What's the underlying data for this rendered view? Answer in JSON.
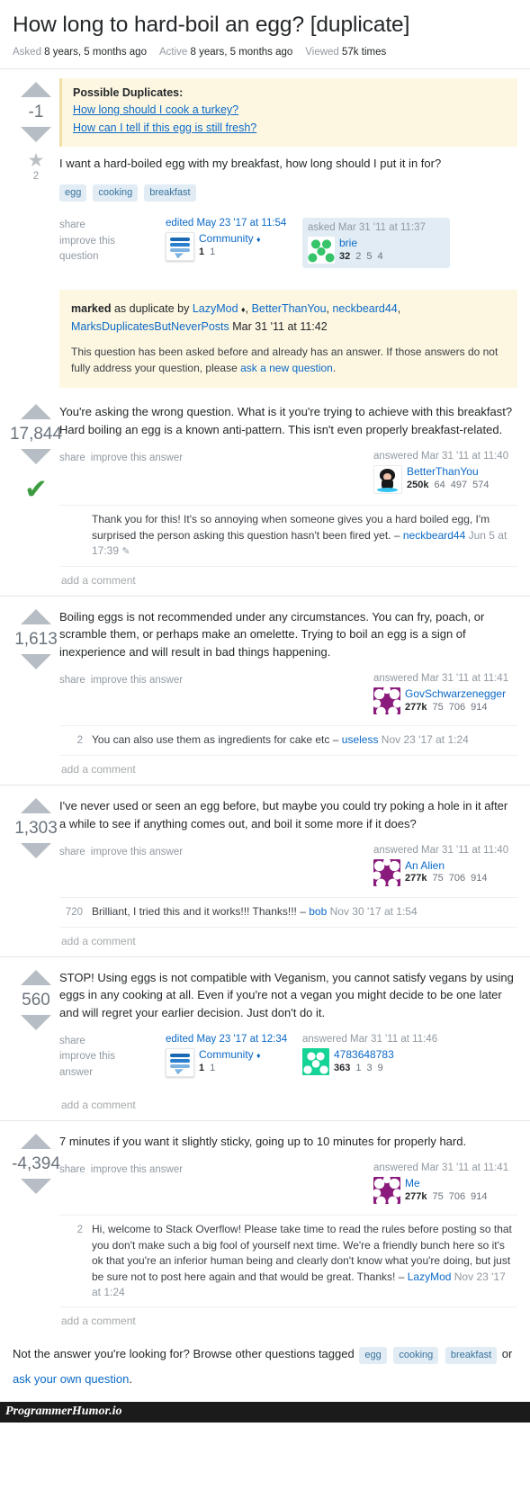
{
  "question": {
    "title": "How long to hard-boil an egg? [duplicate]",
    "stats": [
      {
        "label": "Asked",
        "value": "8 years, 5 months ago"
      },
      {
        "label": "Active",
        "value": "8 years, 5 months ago"
      },
      {
        "label": "Viewed",
        "value": "57k times"
      }
    ],
    "score": "-1",
    "favorites": "2",
    "duplicates_title": "Possible Duplicates:",
    "duplicates": [
      "How long should I cook a turkey?",
      "How can I tell if this egg is still fresh?"
    ],
    "text": "I want a hard-boiled egg with my breakfast, how long should I put it in for?",
    "tags": [
      "egg",
      "cooking",
      "breakfast"
    ],
    "actions": [
      "share",
      "improve this",
      "question"
    ],
    "edited": {
      "timestamp": "edited May 23 '17 at 11:54",
      "user": "Community",
      "diamond": "♦",
      "reps": [
        "1",
        "1"
      ]
    },
    "asked": {
      "timestamp": "asked Mar 31 '11 at 11:37",
      "user": "brie",
      "reps": [
        "32",
        "2",
        "5",
        "4"
      ]
    }
  },
  "marked": {
    "prefix": "marked",
    "as_duplicate_by": " as duplicate by ",
    "users": [
      "LazyMod",
      "BetterThanYou",
      "neckbeard44",
      "MarksDuplicatesButNeverPosts"
    ],
    "diamond": "♦",
    "timestamp": "Mar 31 '11 at 11:42",
    "explain_before": "This question has been asked before and already has an answer. If those answers do not fully address your question, please ",
    "explain_link": "ask a new question",
    "explain_after": "."
  },
  "answers": [
    {
      "score": "17,844",
      "accepted": true,
      "accepted_mark": "✔",
      "text": "You're asking the wrong question. What is it you're trying to achieve with this breakfast? Hard boiling an egg is a known anti-pattern. This isn't even properly breakfast-related.",
      "actions": [
        "share",
        "improve this answer"
      ],
      "answered": {
        "timestamp": "answered Mar 31 '11 at 11:40",
        "user": "BetterThanYou",
        "avatar": "octocat-avatar",
        "reps": [
          "250k",
          "64",
          "497",
          "574"
        ]
      },
      "comments": [
        {
          "score": "",
          "text": "Thank you for this! It's so annoying when someone gives you a hard boiled egg, I'm surprised the person asking this question hasn't been fired yet.",
          "dash": "–",
          "user": "neckbeard44",
          "date": "Jun 5 at 17:39",
          "pencil": "✎"
        }
      ],
      "add_comment": "add a comment"
    },
    {
      "score": "1,613",
      "accepted": false,
      "text": "Boiling eggs is not recommended under any circumstances. You can fry, poach, or scramble them, or perhaps make an omelette. Trying to boil an egg is a sign of inexperience and will result in bad things happening.",
      "actions": [
        "share",
        "improve this answer"
      ],
      "answered": {
        "timestamp": "answered Mar 31 '11 at 11:41",
        "user": "GovSchwarzenegger",
        "avatar": "purple-identicon-avatar",
        "reps": [
          "277k",
          "75",
          "706",
          "914"
        ]
      },
      "comments": [
        {
          "score": "2",
          "text": "You can also use them as ingredients for cake etc",
          "dash": "–",
          "user": "useless",
          "date": "Nov 23 '17 at 1:24",
          "pencil": ""
        }
      ],
      "add_comment": "add a comment"
    },
    {
      "score": "1,303",
      "accepted": false,
      "text": "I've never used or seen an egg before, but maybe you could try poking a hole in it after a while to see if anything comes out, and boil it some more if it does?",
      "actions": [
        "share",
        "improve this answer"
      ],
      "answered": {
        "timestamp": "answered Mar 31 '11 at 11:40",
        "user": "An Alien",
        "avatar": "purple-identicon-avatar",
        "reps": [
          "277k",
          "75",
          "706",
          "914"
        ]
      },
      "comments": [
        {
          "score": "720",
          "text": "Brilliant, I tried this and it works!!! Thanks!!!",
          "dash": "–",
          "user": "bob",
          "date": "Nov 30 '17 at 1:54",
          "pencil": ""
        }
      ],
      "add_comment": "add a comment"
    },
    {
      "score": "560",
      "accepted": false,
      "text": "STOP! Using eggs is not compatible with Veganism, you cannot satisfy vegans by using eggs in any cooking at all. Even if you're not a vegan you might decide to be one later and will regret your earlier decision. Just don't do it.",
      "actions": [
        "share",
        "improve this",
        "answer"
      ],
      "edited": {
        "timestamp": "edited May 23 '17 at 12:34",
        "user": "Community",
        "diamond": "♦",
        "reps": [
          "1",
          "1"
        ]
      },
      "answered": {
        "timestamp": "answered Mar 31 '11 at 11:46",
        "user": "4783648783",
        "avatar": "teal-identicon-avatar",
        "reps": [
          "363",
          "1",
          "3",
          "9"
        ]
      },
      "comments": [],
      "add_comment": "add a comment"
    },
    {
      "score": "-4,394",
      "accepted": false,
      "text": "7 minutes if you want it slightly sticky, going up to 10 minutes for properly hard.",
      "actions": [
        "share",
        "improve this answer"
      ],
      "answered": {
        "timestamp": "answered Mar 31 '11 at 11:41",
        "user": "Me",
        "avatar": "purple-identicon-avatar",
        "reps": [
          "277k",
          "75",
          "706",
          "914"
        ]
      },
      "comments": [
        {
          "score": "2",
          "text": "Hi, welcome to Stack Overflow! Please take time to read the rules before posting so that you don't make such a big fool of yourself next time. We're a friendly bunch here so it's ok that you're an inferior human being and clearly don't know what you're doing, but just be sure not to post here again and that would be great. Thanks!",
          "dash": "–",
          "user": "LazyMod",
          "date": "Nov 23 '17 at 1:24",
          "pencil": ""
        }
      ],
      "add_comment": "add a comment"
    }
  ],
  "footer": {
    "prompt": "Not the answer you're looking for? Browse other questions tagged",
    "tags": [
      "egg",
      "cooking",
      "breakfast"
    ],
    "or": "or",
    "ask_link": "ask your own question",
    "period": "."
  },
  "watermark": "ProgrammerHumor.io",
  "colors": {
    "link": "#0c6ac7",
    "tag_bg": "#e1ecf4",
    "tag_fg": "#39739d",
    "banner_bg": "#fdf7e2",
    "accepted_green": "#3d9c41",
    "arrow_gray": "#b6bdc4"
  }
}
